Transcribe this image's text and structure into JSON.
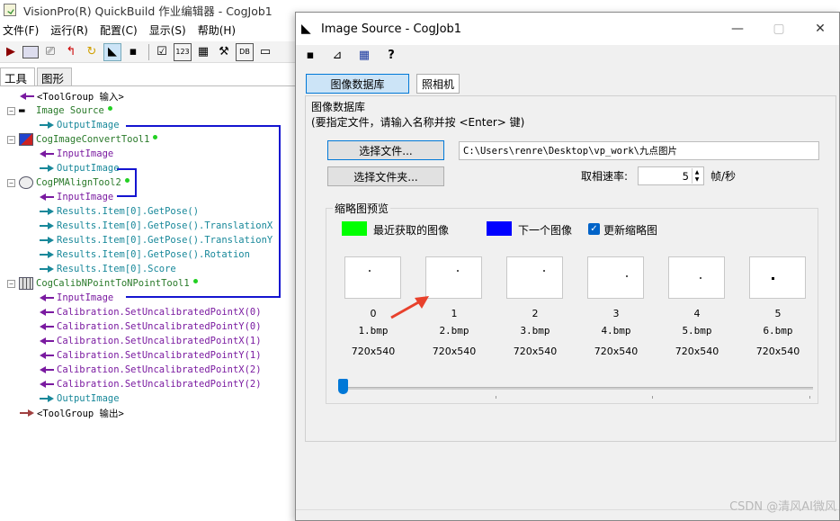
{
  "main": {
    "title": "VisionPro(R) QuickBuild 作业编辑器 - CogJob1",
    "menu": [
      "文件(F)",
      "运行(R)",
      "配置(C)",
      "显示(S)",
      "帮助(H)"
    ],
    "tabs": [
      "工具",
      "图形"
    ],
    "tree": [
      {
        "text": "<ToolGroup 输入>"
      },
      {
        "text": "Image Source"
      },
      {
        "text": "OutputImage"
      },
      {
        "text": "CogImageConvertTool1"
      },
      {
        "text": "InputImage"
      },
      {
        "text": "OutputImage"
      },
      {
        "text": "CogPMAlignTool2"
      },
      {
        "text": "InputImage"
      },
      {
        "text": "Results.Item[0].GetPose()"
      },
      {
        "text": "Results.Item[0].GetPose().TranslationX"
      },
      {
        "text": "Results.Item[0].GetPose().TranslationY"
      },
      {
        "text": "Results.Item[0].GetPose().Rotation"
      },
      {
        "text": "Results.Item[0].Score"
      },
      {
        "text": "CogCalibNPointToNPointTool1"
      },
      {
        "text": "InputImage"
      },
      {
        "text": "Calibration.SetUncalibratedPointX(0)"
      },
      {
        "text": "Calibration.SetUncalibratedPointY(0)"
      },
      {
        "text": "Calibration.SetUncalibratedPointX(1)"
      },
      {
        "text": "Calibration.SetUncalibratedPointY(1)"
      },
      {
        "text": "Calibration.SetUncalibratedPointX(2)"
      },
      {
        "text": "Calibration.SetUncalibratedPointY(2)"
      },
      {
        "text": "OutputImage"
      },
      {
        "text": "<ToolGroup 输出>"
      }
    ]
  },
  "dialog": {
    "title": "Image Source - CogJob1",
    "tabs": {
      "database": "图像数据库",
      "camera": "照相机"
    },
    "section_title": "图像数据库",
    "hint": "(要指定文件，请输入名称并按 <Enter> 键)",
    "select_file": "选择文件...",
    "select_folder": "选择文件夹...",
    "path": "C:\\Users\\renre\\Desktop\\vp_work\\九点图片",
    "rate_label": "取相速率:",
    "rate_value": "5",
    "rate_unit": "帧/秒",
    "thumbs_group": "缩略图预览",
    "legend_latest": "最近获取的图像",
    "legend_next": "下一个图像",
    "update_thumbs": "更新缩略图",
    "colors": {
      "latest": "#00ff00",
      "next": "#0000ff",
      "tree_link": "#1414d0"
    },
    "thumbnails": [
      {
        "index": "0",
        "name": "1.bmp",
        "size": "720x540"
      },
      {
        "index": "1",
        "name": "2.bmp",
        "size": "720x540"
      },
      {
        "index": "2",
        "name": "3.bmp",
        "size": "720x540"
      },
      {
        "index": "3",
        "name": "4.bmp",
        "size": "720x540"
      },
      {
        "index": "4",
        "name": "5.bmp",
        "size": "720x540"
      },
      {
        "index": "5",
        "name": "6.bmp",
        "size": "720x540"
      }
    ]
  },
  "watermark": "CSDN @清风AI微风"
}
